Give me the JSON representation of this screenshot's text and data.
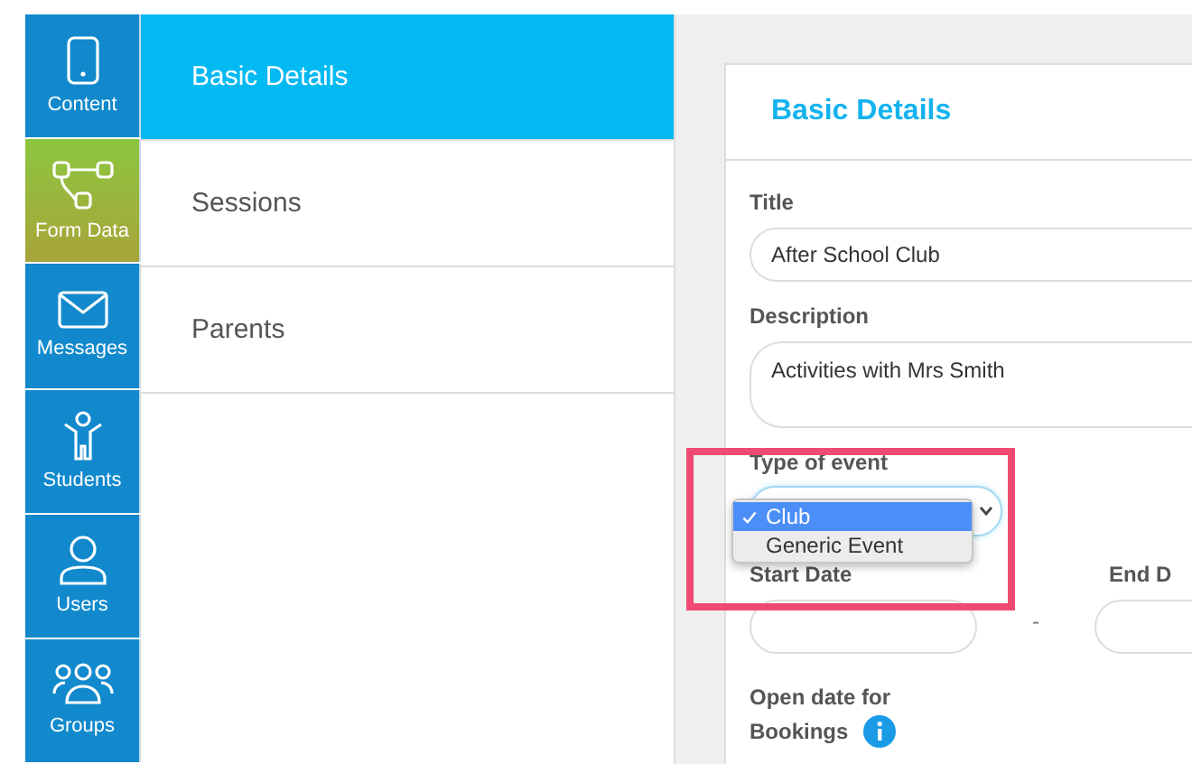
{
  "nav": [
    {
      "label": "Content",
      "kind": "phone",
      "selected": false
    },
    {
      "label": "Form Data",
      "kind": "flow",
      "selected": true
    },
    {
      "label": "Messages",
      "kind": "mail",
      "selected": false
    },
    {
      "label": "Students",
      "kind": "child",
      "selected": false
    },
    {
      "label": "Users",
      "kind": "user",
      "selected": false
    },
    {
      "label": "Groups",
      "kind": "group",
      "selected": false
    }
  ],
  "sections": [
    {
      "label": "Basic Details",
      "selected": true
    },
    {
      "label": "Sessions",
      "selected": false
    },
    {
      "label": "Parents",
      "selected": false
    }
  ],
  "form": {
    "title": "Basic Details",
    "title_field": {
      "label": "Title",
      "value": "After School Club"
    },
    "description": {
      "label": "Description",
      "value": "Activities with Mrs Smith"
    },
    "event_type": {
      "label": "Type of event",
      "options": [
        {
          "label": "Club",
          "selected": true
        },
        {
          "label": "Generic Event",
          "selected": false
        }
      ]
    },
    "start_date": {
      "label": "Start Date"
    },
    "separator": "-",
    "end_date": {
      "label": "End D"
    },
    "open_date": {
      "label": "Open date for",
      "label_2": "Bookings"
    }
  }
}
